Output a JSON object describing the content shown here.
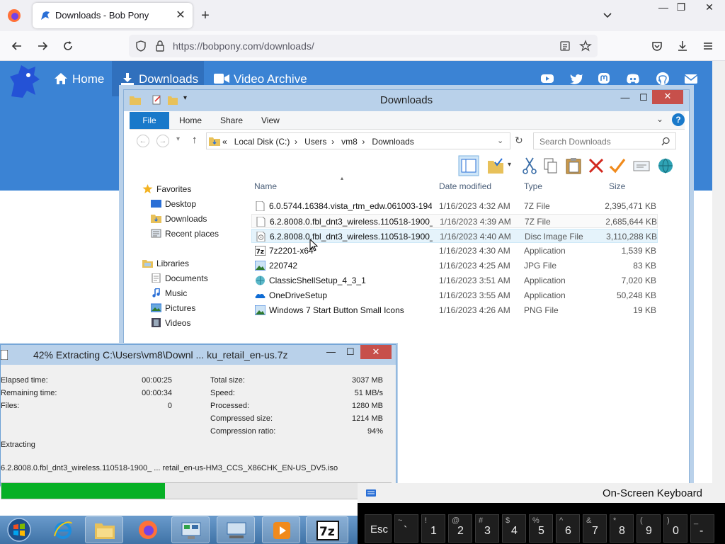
{
  "browser": {
    "tab_title": "Downloads - Bob Pony",
    "url_host": "https://bobpony.com",
    "url_path": "/downloads/"
  },
  "site": {
    "nav": [
      {
        "label": "Home",
        "icon": "home-icon"
      },
      {
        "label": "Downloads",
        "icon": "download-icon"
      },
      {
        "label": "Video Archive",
        "icon": "video-icon"
      }
    ],
    "social_icons": [
      "youtube-icon",
      "twitter-icon",
      "mastodon-icon",
      "discord-icon",
      "github-icon",
      "email-icon"
    ],
    "header_color": "#3b83d4"
  },
  "explorer": {
    "title": "Downloads",
    "ribbon_tabs": [
      "File",
      "Home",
      "Share",
      "View"
    ],
    "address": {
      "prefix": "«",
      "segments": [
        "Local Disk (C:)",
        "Users",
        "vm8",
        "Downloads"
      ]
    },
    "search_placeholder": "Search Downloads",
    "columns": [
      "Name",
      "Date modified",
      "Type",
      "Size"
    ],
    "nav_pane": {
      "favorites_label": "Favorites",
      "favorites": [
        "Desktop",
        "Downloads",
        "Recent places"
      ],
      "libraries_label": "Libraries",
      "libraries": [
        "Documents",
        "Music",
        "Pictures",
        "Videos"
      ]
    },
    "files": [
      {
        "name": "6.0.5744.16384.vista_rtm_edw.061003-194...",
        "date": "1/16/2023 4:32 AM",
        "type": "7Z File",
        "size": "2,395,471 KB",
        "icon": "file-icon"
      },
      {
        "name": "6.2.8008.0.fbl_dnt3_wireless.110518-1900_...",
        "date": "1/16/2023 4:39 AM",
        "type": "7Z File",
        "size": "2,685,644 KB",
        "icon": "file-icon"
      },
      {
        "name": "6.2.8008.0.fbl_dnt3_wireless.110518-1900_...",
        "date": "1/16/2023 4:40 AM",
        "type": "Disc Image File",
        "size": "3,110,288 KB",
        "icon": "disc-icon"
      },
      {
        "name": "7z2201-x64",
        "date": "1/16/2023 4:30 AM",
        "type": "Application",
        "size": "1,539 KB",
        "icon": "7zip-icon"
      },
      {
        "name": "220742",
        "date": "1/16/2023 4:25 AM",
        "type": "JPG File",
        "size": "83 KB",
        "icon": "image-icon"
      },
      {
        "name": "ClassicShellSetup_4_3_1",
        "date": "1/16/2023 3:51 AM",
        "type": "Application",
        "size": "7,020 KB",
        "icon": "shell-icon"
      },
      {
        "name": "OneDriveSetup",
        "date": "1/16/2023 3:55 AM",
        "type": "Application",
        "size": "50,248 KB",
        "icon": "onedrive-icon"
      },
      {
        "name": "Windows 7 Start Button Small Icons",
        "date": "1/16/2023 4:26 AM",
        "type": "PNG File",
        "size": "19 KB",
        "icon": "image-icon"
      }
    ]
  },
  "zip": {
    "title": "42% Extracting C:\\Users\\vm8\\Downl ... ku_retail_en-us.7z",
    "left_labels": [
      "Elapsed time:",
      "Remaining time:",
      "Files:"
    ],
    "left_values": [
      "00:00:25",
      "00:00:34",
      "0"
    ],
    "right_labels": [
      "Total size:",
      "Speed:",
      "Processed:",
      "Compressed size:",
      "Compression ratio:"
    ],
    "right_values": [
      "3037 MB",
      "51 MB/s",
      "1280 MB",
      "1214 MB",
      "94%"
    ],
    "status": "Extracting",
    "current_file": "6.2.8008.0.fbl_dnt3_wireless.110518-1900_ ... retail_en-us-HM3_CCS_X86CHK_EN-US_DV5.iso",
    "progress": 0.42,
    "progress_color": "#06b025"
  },
  "osk": {
    "title": "On-Screen Keyboard",
    "esc_label": "Esc",
    "keys": [
      {
        "top": "~",
        "bottom": "`"
      },
      {
        "top": "!",
        "bottom": "1"
      },
      {
        "top": "@",
        "bottom": "2"
      },
      {
        "top": "#",
        "bottom": "3"
      },
      {
        "top": "$",
        "bottom": "4"
      },
      {
        "top": "%",
        "bottom": "5"
      },
      {
        "top": "^",
        "bottom": "6"
      },
      {
        "top": "&",
        "bottom": "7"
      },
      {
        "top": "*",
        "bottom": "8"
      },
      {
        "top": "(",
        "bottom": "9"
      },
      {
        "top": ")",
        "bottom": "0"
      },
      {
        "top": "_",
        "bottom": "-"
      }
    ]
  },
  "taskbar": {
    "apps": [
      "internet-explorer-icon",
      "file-explorer-icon",
      "firefox-icon",
      "control-panel-icon",
      "on-screen-keyboard-icon",
      "media-player-icon",
      "7zip-icon"
    ]
  }
}
